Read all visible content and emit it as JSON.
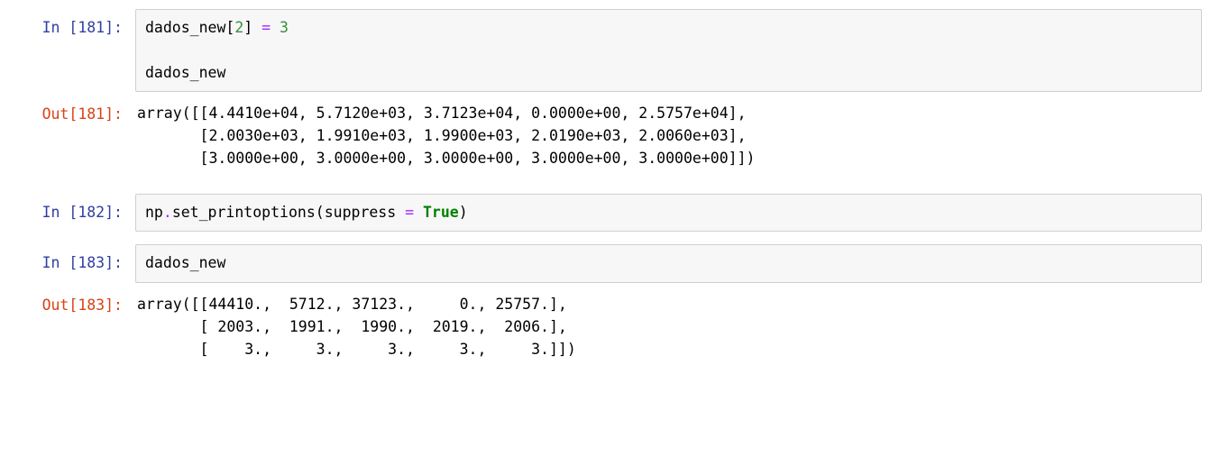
{
  "cells": [
    {
      "type": "in",
      "prompt_label": "In ",
      "exec_count": "181",
      "code_tokens": [
        {
          "cls": "tok-name",
          "t": "dados_new"
        },
        {
          "cls": "tok-punct",
          "t": "["
        },
        {
          "cls": "tok-num",
          "t": "2"
        },
        {
          "cls": "tok-punct",
          "t": "]"
        },
        {
          "cls": "tok-punct",
          "t": " "
        },
        {
          "cls": "tok-op",
          "t": "="
        },
        {
          "cls": "tok-punct",
          "t": " "
        },
        {
          "cls": "tok-num",
          "t": "3"
        },
        {
          "cls": "tok-punct",
          "t": "\n\n"
        },
        {
          "cls": "tok-name",
          "t": "dados_new"
        }
      ]
    },
    {
      "type": "out",
      "prompt_label": "Out",
      "exec_count": "181",
      "output_text": "array([[4.4410e+04, 5.7120e+03, 3.7123e+04, 0.0000e+00, 2.5757e+04],\n       [2.0030e+03, 1.9910e+03, 1.9900e+03, 2.0190e+03, 2.0060e+03],\n       [3.0000e+00, 3.0000e+00, 3.0000e+00, 3.0000e+00, 3.0000e+00]])"
    },
    {
      "type": "in",
      "prompt_label": "In ",
      "exec_count": "182",
      "code_tokens": [
        {
          "cls": "tok-name",
          "t": "np"
        },
        {
          "cls": "tok-op",
          "t": "."
        },
        {
          "cls": "tok-name",
          "t": "set_printoptions"
        },
        {
          "cls": "tok-punct",
          "t": "("
        },
        {
          "cls": "tok-name",
          "t": "suppress"
        },
        {
          "cls": "tok-punct",
          "t": " "
        },
        {
          "cls": "tok-op",
          "t": "="
        },
        {
          "cls": "tok-punct",
          "t": " "
        },
        {
          "cls": "tok-kw",
          "t": "True"
        },
        {
          "cls": "tok-punct",
          "t": ")"
        }
      ]
    },
    {
      "type": "in",
      "prompt_label": "In ",
      "exec_count": "183",
      "code_tokens": [
        {
          "cls": "tok-name",
          "t": "dados_new"
        }
      ]
    },
    {
      "type": "out",
      "prompt_label": "Out",
      "exec_count": "183",
      "output_text": "array([[44410.,  5712., 37123.,     0., 25757.],\n       [ 2003.,  1991.,  1990.,  2019.,  2006.],\n       [    3.,     3.,     3.,     3.,     3.]])"
    }
  ]
}
